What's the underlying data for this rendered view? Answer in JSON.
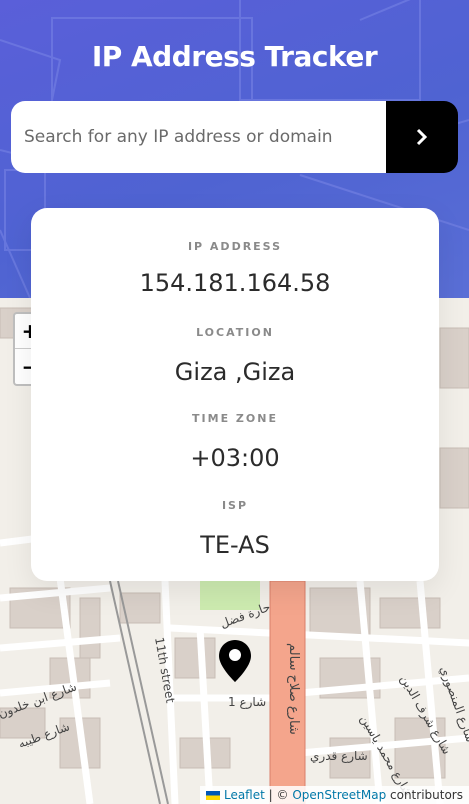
{
  "header": {
    "title": "IP Address Tracker"
  },
  "search": {
    "placeholder": "Search for any IP address or domain",
    "value": "",
    "submit_icon": "chevron-right-icon"
  },
  "info": {
    "ip_label": "IP ADDRESS",
    "ip_value": "154.181.164.58",
    "location_label": "LOCATION",
    "location_value": "Giza ,Giza",
    "timezone_label": "TIME ZONE",
    "timezone_value": "+03:00",
    "isp_label": "ISP",
    "isp_value": "TE-AS"
  },
  "map": {
    "zoom_in": "+",
    "zoom_out": "−",
    "marker_icon": "map-pin-icon",
    "labels": {
      "street_11": "11th street",
      "street_salah_salem": "شارع صلاح سالم",
      "street_fadl": "حارة فضل",
      "street_1": "شارع 1",
      "street_ibn_khaldoun": "شارع ابن خلدون",
      "street_mohamed_yassin": "شارع محمد ياسين",
      "street_qadri": "شارع قدري",
      "street_sharaf_eldin": "شارع شرف الدين",
      "street_mansouri": "شارع المنصوري",
      "street_tayba": "شارع طيبه"
    },
    "attribution": {
      "leaflet": "Leaflet",
      "separator": "| ©",
      "osm": "OpenStreetMap",
      "contributors": "contributors"
    }
  },
  "colors": {
    "hero": "#5163d3",
    "button": "#000000",
    "main_road": "#f4a58c"
  }
}
